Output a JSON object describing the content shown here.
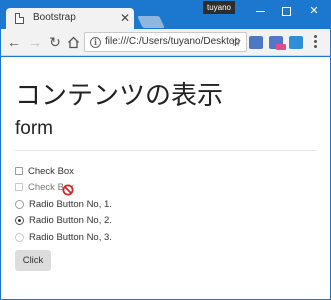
{
  "browser": {
    "tab_title": "Bootstrap",
    "profile_name": "tuyano",
    "url": "file:///C:/Users/tuyano/Desktop"
  },
  "page": {
    "title": "コンテンツの表示",
    "section_title": "form",
    "checkboxes": [
      {
        "label": "Check Box",
        "checked": false,
        "disabled": false
      },
      {
        "label": "Check Box",
        "checked": false,
        "disabled": true
      }
    ],
    "radios": [
      {
        "label": "Radio Button No, 1.",
        "checked": false
      },
      {
        "label": "Radio Button No, 2.",
        "checked": true
      },
      {
        "label": "Radio Button No, 3.",
        "checked": false
      }
    ],
    "button_label": "Click"
  },
  "colors": {
    "titlebar": "#1c78cf",
    "cursor_not_allowed": "#cc2a2a"
  }
}
